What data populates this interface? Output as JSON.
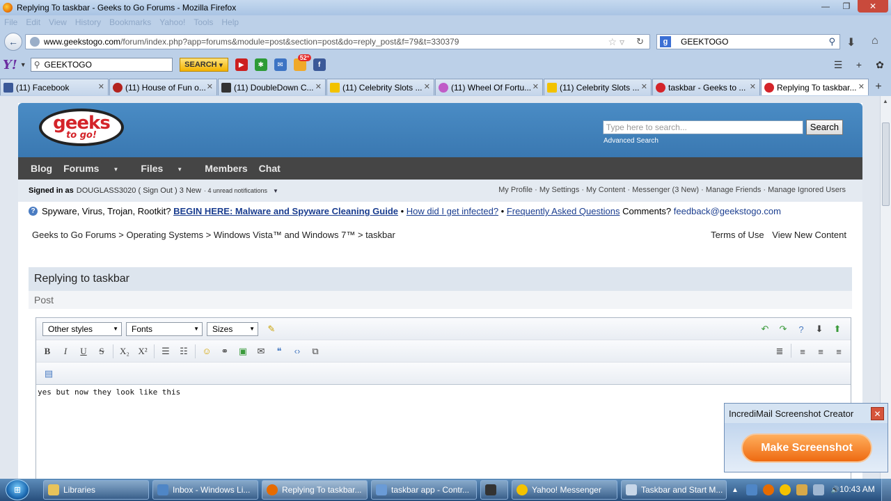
{
  "window": {
    "title": "Replying To taskbar - Geeks to Go Forums - Mozilla Firefox",
    "controls": [
      "—",
      "❐",
      "✕"
    ]
  },
  "menu": [
    "File",
    "Edit",
    "View",
    "History",
    "Bookmarks",
    "Yahoo!",
    "Tools",
    "Help"
  ],
  "nav": {
    "url_domain": "www.geekstogo.com",
    "url_path": "/forum/index.php?app=forums&module=post&section=post&do=reply_post&f=79&t=330379",
    "search_value": "GEEKTOGO",
    "search_engine_letter": "g"
  },
  "yahoo_toolbar": {
    "logo": "Y!",
    "search_value": "GEEKTOGO",
    "search_button": "SEARCH",
    "weather_badge": "52°"
  },
  "tabs": [
    {
      "label": "(11) Facebook",
      "color": "#3b5998"
    },
    {
      "label": "(11) House of Fun o...",
      "color": "#b3231e"
    },
    {
      "label": "(11) DoubleDown C...",
      "color": "#333333"
    },
    {
      "label": "(11) Celebrity Slots ...",
      "color": "#f2c200"
    },
    {
      "label": "(11) Wheel Of Fortu...",
      "color": "#c05cc7"
    },
    {
      "label": "(11) Celebrity Slots ...",
      "color": "#f2c200"
    },
    {
      "label": "taskbar - Geeks to ...",
      "color": "#d4242a"
    },
    {
      "label": "Replying To taskbar...",
      "color": "#d4242a"
    }
  ],
  "site": {
    "logo_line1": "geeks",
    "logo_line2": "to go!",
    "search_placeholder": "Type here to search...",
    "search_button": "Search",
    "advanced_search": "Advanced Search",
    "nav": [
      "Blog",
      "Forums",
      "Files",
      "Members",
      "Chat"
    ],
    "userbar": {
      "signed_in_label": "Signed in as",
      "username": "DOUGLASS3020",
      "sign_out": "( Sign Out )",
      "new": "3 New",
      "notifications": "· 4 unread notifications",
      "links": "My Profile · My Settings · My Content · Messenger (3 New) · Manage Friends · Manage Ignored Users"
    },
    "announce": {
      "intro": "Spyware, Virus, Trojan, Rootkit?",
      "link1": "BEGIN HERE: Malware and Spyware Cleaning Guide",
      "sep1": "•",
      "link2": "How did I get infected?",
      "sep2": "•",
      "link3": "Frequently Asked Questions",
      "comments": "Comments?",
      "email": "feedback@geekstogo.com"
    },
    "breadcrumb": "Geeks to Go Forums > Operating Systems > Windows Vista™ and Windows 7™ > taskbar",
    "toplinks": [
      "Terms of Use",
      "View New Content"
    ],
    "reply_title": "Replying to taskbar",
    "post_label": "Post"
  },
  "editor": {
    "selects": [
      "Other styles",
      "Fonts",
      "Sizes"
    ],
    "text": "yes  but now they look like this"
  },
  "incredimail": {
    "title": "IncrediMail Screenshot Creator",
    "button": "Make Screenshot"
  },
  "taskbar": {
    "items": [
      {
        "label": "Libraries",
        "color": "#e8c35a"
      },
      {
        "label": "Inbox - Windows Li...",
        "color": "#4f86c6"
      },
      {
        "label": "Replying To taskbar...",
        "color": "#e66b00"
      },
      {
        "label": "taskbar app - Contr...",
        "color": "#6a9bd6"
      },
      {
        "label": "",
        "color": "#333333"
      },
      {
        "label": "Yahoo! Messenger",
        "color": "#f3c200"
      },
      {
        "label": "Taskbar and Start M...",
        "color": "#c7d6e8"
      }
    ],
    "clock": "10:43 AM"
  }
}
